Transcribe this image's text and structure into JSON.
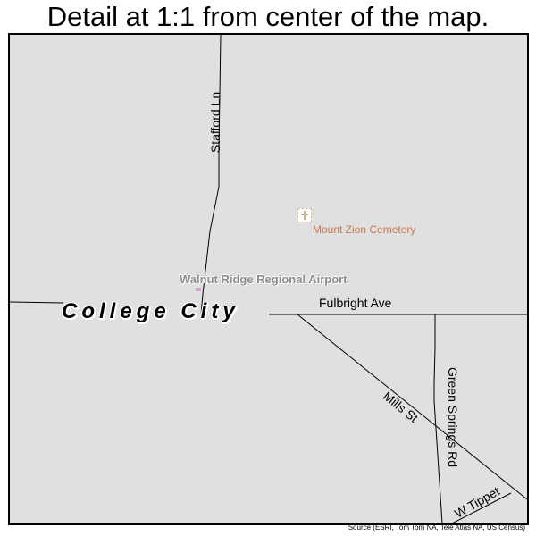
{
  "title": "Detail at 1:1 from center of the map.",
  "map": {
    "background_color": "#e0e0e0",
    "city_label": "College City",
    "streets": [
      {
        "name": "Stafford Ln",
        "orientation": "vertical"
      },
      {
        "name": "Fulbright Ave",
        "orientation": "horizontal"
      },
      {
        "name": "Mills St",
        "orientation": "diagonal"
      },
      {
        "name": "Green Springs Rd",
        "orientation": "vertical"
      },
      {
        "name": "W Tippet",
        "orientation": "diagonal"
      }
    ],
    "pois": {
      "airport": {
        "label": "Walnut Ridge Regional Airport",
        "icon": "airport-icon",
        "color": "#d79ccf"
      },
      "cemetery": {
        "label": "Mount Zion Cemetery",
        "icon": "cross-icon",
        "color": "#c87850"
      }
    }
  },
  "source": "Source (ESRI, Tom Tom NA, Tele Atlas NA, US Census)"
}
